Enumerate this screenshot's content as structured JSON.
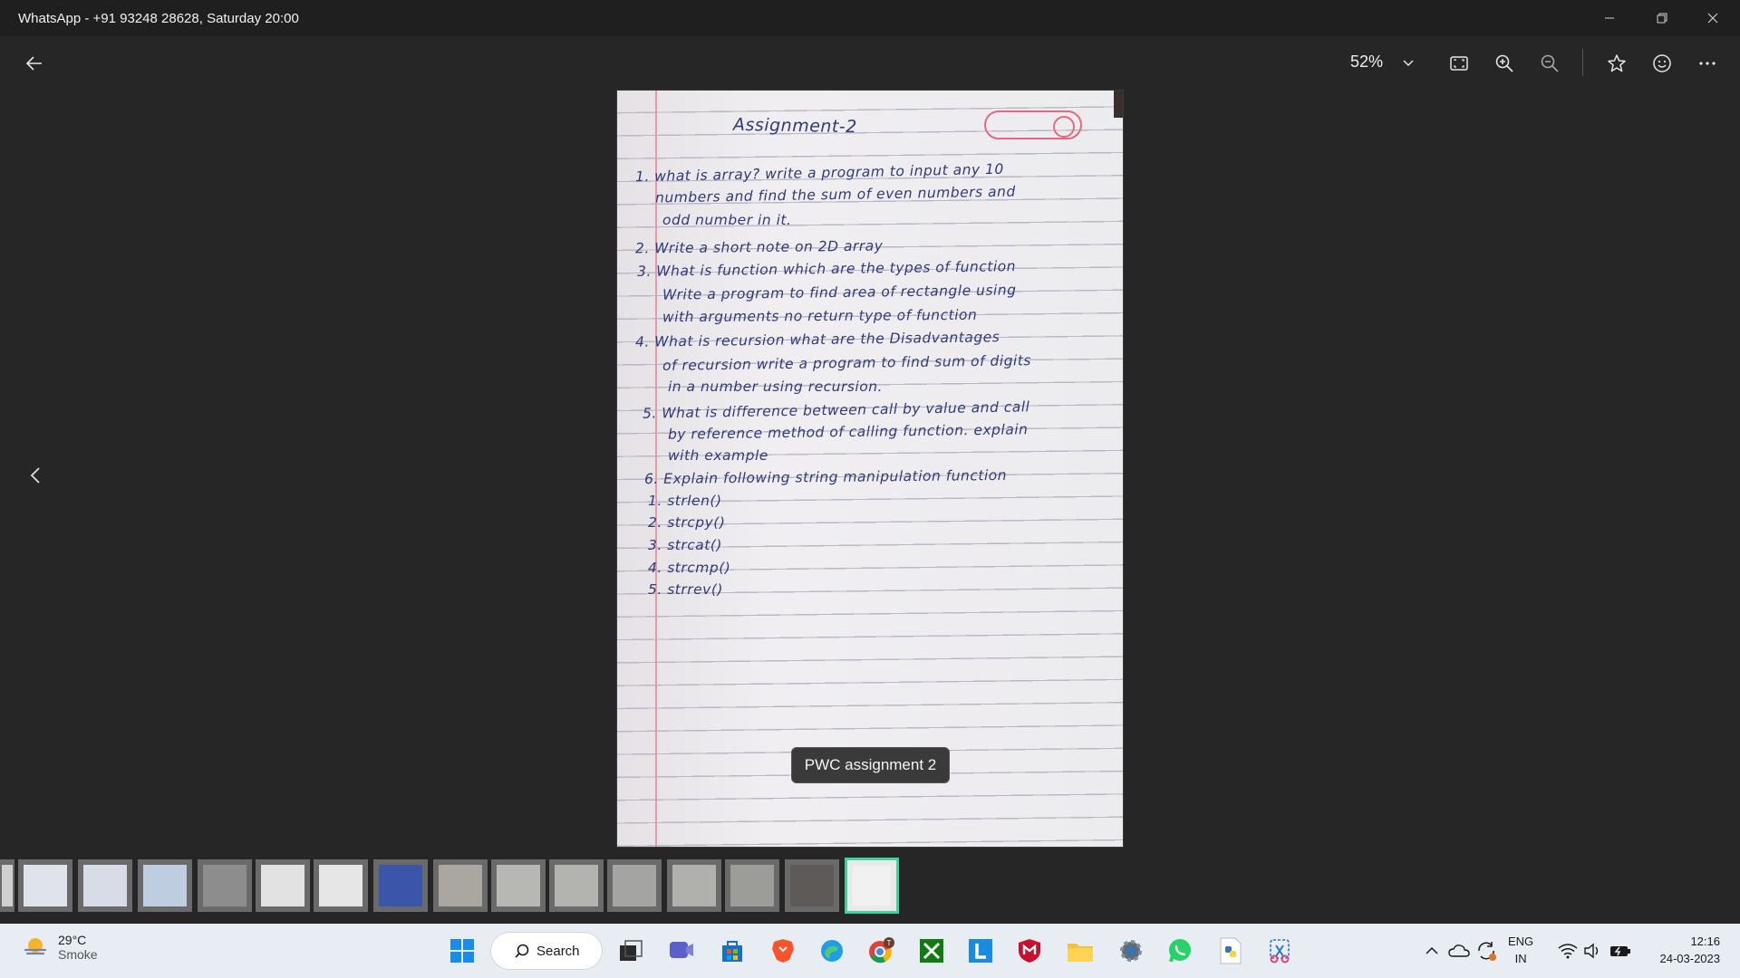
{
  "window": {
    "title": "WhatsApp - +91 93248 28628, Saturday 20:00"
  },
  "toolbar": {
    "zoom": "52%"
  },
  "document": {
    "title": "Assignment-2",
    "lines": [
      "1. what is array? write a program to input any 10",
      "numbers and find the sum of even numbers and",
      "odd number in it.",
      "2. Write a short note on 2D array",
      "3. What is function which are the types of function",
      "Write a program to find area of rectangle using",
      "with arguments no return type of function",
      "4. What is recursion what are the Disadvantages",
      "of recursion write a program to find sum of digits",
      "in a number using recursion.",
      "5. What is difference between call by value and call",
      "by reference method of calling function. explain",
      "with example",
      "6. Explain following string manipulation function",
      "1. strlen()",
      "2. strcpy()",
      "3. strcat()",
      "4. strcmp()",
      "5. strrev()"
    ]
  },
  "caption": "PWC assignment 2",
  "taskbar": {
    "weather_temp": "29°C",
    "weather_desc": "Smoke",
    "search_label": "Search",
    "lang_line1": "ENG",
    "lang_line2": "IN",
    "time": "12:16",
    "date": "24-03-2023",
    "chrome_badge": "T"
  },
  "colors": {
    "accent_selected": "#3ed39a",
    "ink": "#2f3a7a",
    "margin_red": "#e49aa8"
  }
}
